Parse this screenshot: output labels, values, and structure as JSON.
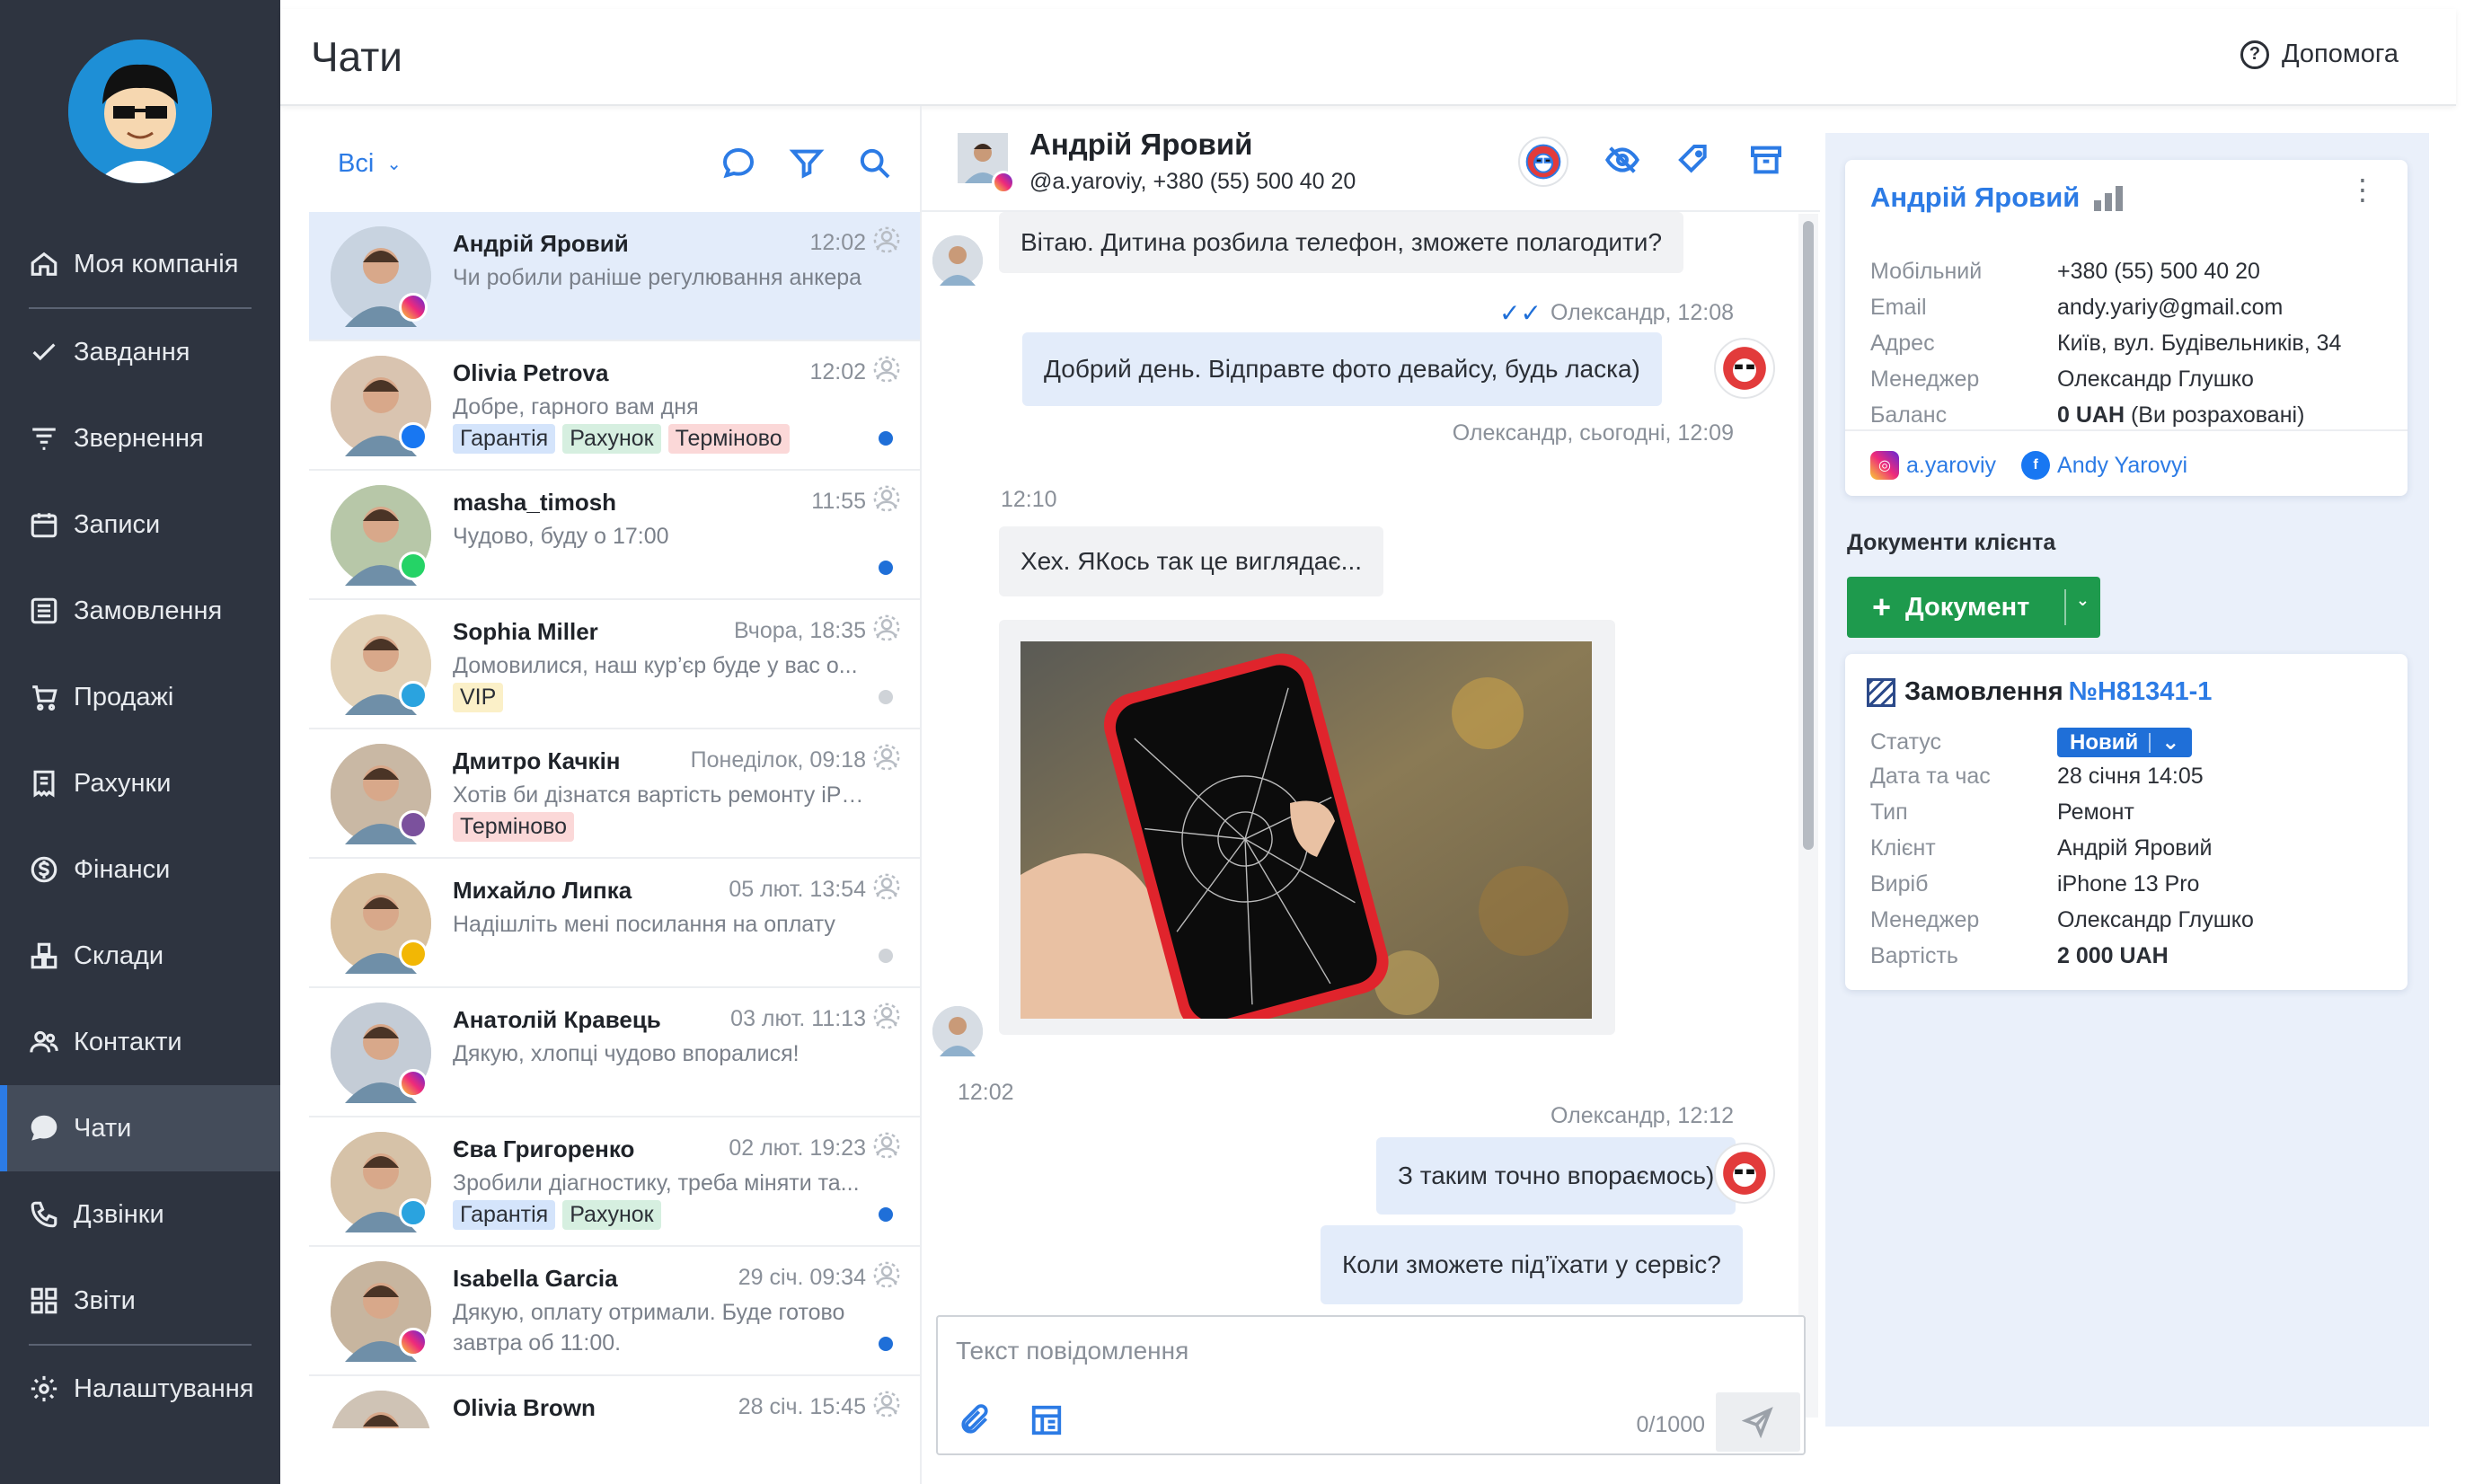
{
  "header": {
    "title": "Чати",
    "help_label": "Допомога"
  },
  "sidebar": {
    "items": [
      {
        "label": "Моя компанія",
        "icon": "home-icon"
      },
      {
        "label": "Завдання",
        "icon": "check-icon"
      },
      {
        "label": "Звернення",
        "icon": "funnel-icon"
      },
      {
        "label": "Записи",
        "icon": "calendar-icon"
      },
      {
        "label": "Замовлення",
        "icon": "orders-icon"
      },
      {
        "label": "Продажі",
        "icon": "cart-icon"
      },
      {
        "label": "Рахунки",
        "icon": "invoice-icon"
      },
      {
        "label": "Фінанси",
        "icon": "dollar-icon"
      },
      {
        "label": "Склади",
        "icon": "boxes-icon"
      },
      {
        "label": "Контакти",
        "icon": "contacts-icon"
      },
      {
        "label": "Чати",
        "icon": "chat-icon",
        "active": true
      },
      {
        "label": "Дзвінки",
        "icon": "phone-icon"
      },
      {
        "label": "Звіти",
        "icon": "reports-icon"
      },
      {
        "label": "Налаштування",
        "icon": "gear-icon"
      }
    ]
  },
  "chat_list": {
    "filter_label": "Всі",
    "chats": [
      {
        "name": "Андрій Яровий",
        "time": "12:02",
        "message": "Чи робили раніше регулювання анкера",
        "channel": "instagram",
        "tags": [],
        "status": "none",
        "active": true
      },
      {
        "name": "Olivia Petrova",
        "time": "12:02",
        "message": "Добре, гарного вам дня",
        "channel": "facebook",
        "tags": [
          {
            "label": "Гарантія",
            "color": "blue"
          },
          {
            "label": "Рахунок",
            "color": "green"
          },
          {
            "label": "Терміново",
            "color": "red"
          }
        ],
        "status": "unread"
      },
      {
        "name": "masha_timosh",
        "time": "11:55",
        "message": "Чудово, буду о 17:00",
        "channel": "whatsapp",
        "tags": [],
        "status": "unread"
      },
      {
        "name": "Sophia Miller",
        "time": "Вчора, 18:35",
        "message": "Домовилися, наш кур’єр буде у вас о...",
        "channel": "telegram",
        "tags": [
          {
            "label": "VIP",
            "color": "yellow"
          }
        ],
        "status": "read"
      },
      {
        "name": "Дмитро Качкін",
        "time": "Понеділок, 09:18",
        "message": "Хотів би дізнатся вартість ремонту iPhon...",
        "channel": "viber",
        "tags": [
          {
            "label": "Терміново",
            "color": "red"
          }
        ],
        "status": "none"
      },
      {
        "name": "Михайло Липка",
        "time": "05 лют. 13:54",
        "message": "Надішліть мені посилання на оплату",
        "channel": "widget",
        "tags": [],
        "status": "read"
      },
      {
        "name": "Анатолій Кравець",
        "time": "03 лют. 11:13",
        "message": "Дякую, хлопці чудово впоралися!",
        "channel": "instagram",
        "tags": [],
        "status": "none"
      },
      {
        "name": "Єва Григоренко",
        "time": "02 лют. 19:23",
        "message": "Зробили діагностику, треба міняти та...",
        "channel": "telegram",
        "tags": [
          {
            "label": "Гарантія",
            "color": "blue"
          },
          {
            "label": "Рахунок",
            "color": "green"
          }
        ],
        "status": "unread"
      },
      {
        "name": "Isabella Garcia",
        "time": "29 січ. 09:34",
        "message": "Дякую, оплату отримали. Буде готово завтра об 11:00.",
        "channel": "instagram",
        "tags": [],
        "status": "unread",
        "wrap": true
      },
      {
        "name": "Olivia Brown",
        "time": "28 січ. 15:45",
        "message": "",
        "channel": "none",
        "tags": [],
        "status": "none"
      }
    ]
  },
  "chat": {
    "name": "Андрій Яровий",
    "subtitle": "@a.yaroviy, +380 (55) 500 40 20",
    "messages": {
      "m1": "Вітаю. Дитина розбила телефон, зможете полагодити?",
      "m1_meta": "Олександр, 12:08",
      "m2": "Добрий день. Відправте фото девайсу, будь ласка)",
      "m2_meta": "Олександр, сьогодні, 12:09",
      "t1": "12:10",
      "m3": "Хех. ЯКось так це виглядає...",
      "t2": "12:02",
      "m4_meta": "Олександр, 12:12",
      "m4": "З таким точно впораємось)",
      "m5": "Коли зможете під’їхати у сервіс?"
    },
    "composer": {
      "placeholder": "Текст повідомлення",
      "counter": "0/1000"
    }
  },
  "client": {
    "name": "Андрій Яровий",
    "fields": [
      {
        "k": "Мобільний",
        "v": "+380 (55) 500 40 20"
      },
      {
        "k": "Email",
        "v": "andy.yariy@gmail.com"
      },
      {
        "k": "Адрес",
        "v": "Київ, вул. Будівельників, 34"
      },
      {
        "k": "Менеджер",
        "v": "Олександр Глушко"
      }
    ],
    "balance_label": "Баланс",
    "balance_value": "0 UAH",
    "balance_note": "(Ви розраховані)",
    "instagram": "a.yaroviy",
    "facebook": "Andy Yarovyi"
  },
  "documents": {
    "title": "Документи клієнта",
    "button": "Документ"
  },
  "order": {
    "title": "Замовлення",
    "number": "№Н81341-1",
    "status_label": "Статус",
    "status": "Новий",
    "fields": [
      {
        "k": "Дата та час",
        "v": "28 січня 14:05"
      },
      {
        "k": "Тип",
        "v": "Ремонт"
      },
      {
        "k": "Клієнт",
        "v": "Андрій Яровий"
      },
      {
        "k": "Виріб",
        "v": "iPhone 13 Pro"
      },
      {
        "k": "Менеджер",
        "v": "Олександр Глушко"
      }
    ],
    "price_label": "Вартість",
    "price": "2 000 UAH"
  }
}
